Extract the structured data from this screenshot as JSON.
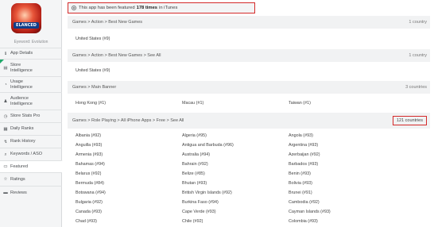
{
  "app": {
    "icon_text": "ELANCED",
    "name": "Eyeword: Evolution"
  },
  "sidebar": {
    "items": [
      {
        "label": "App Details",
        "icon": "info-icon",
        "glyph": "ℹ"
      },
      {
        "label": "Store\nIntelligence",
        "icon": "store-icon",
        "glyph": "▤"
      },
      {
        "label": "Usage\nIntelligence",
        "icon": "usage-icon",
        "glyph": "◔"
      },
      {
        "label": "Audience\nIntelligence",
        "icon": "audience-icon",
        "glyph": "♟"
      },
      {
        "label": "Store Stats Pro",
        "icon": "stats-icon",
        "glyph": "◷"
      },
      {
        "label": "Daily Ranks",
        "icon": "ranks-icon",
        "glyph": "▦"
      },
      {
        "label": "Rank History",
        "icon": "history-icon",
        "glyph": "↯"
      },
      {
        "label": "Keywords / ASO",
        "icon": "keywords-icon",
        "glyph": "⌕"
      },
      {
        "label": "Featured",
        "icon": "featured-icon",
        "glyph": "▭"
      },
      {
        "label": "Ratings",
        "icon": "star-icon",
        "glyph": "☆"
      },
      {
        "label": "Reviews",
        "icon": "reviews-icon",
        "glyph": "▬"
      }
    ],
    "active_index": 8,
    "accent_color": "#1ea868"
  },
  "banner": {
    "prefix": "This app has been featured",
    "count_text": "178 times",
    "suffix": "in iTunes",
    "highlight_color": "#d42a2a"
  },
  "sections": [
    {
      "path": "Games > Action > Best New Games",
      "count": "1 country",
      "rows": [
        [
          "United States (#9)"
        ]
      ]
    },
    {
      "path": "Games > Action > Best New Games > See All",
      "count": "1 country",
      "rows": [
        [
          "United States (#9)"
        ]
      ]
    },
    {
      "path": "Games > Main Banner",
      "count": "3 countries",
      "rows": [
        [
          "Hong Kong (#1)",
          "Macau (#1)",
          "Taiwan (#1)"
        ]
      ]
    },
    {
      "path": "Games > Role Playing > All iPhone Apps > Free > See All",
      "count": "121 countries",
      "rows": [
        [
          "Albania (#92)",
          "Algeria (#95)",
          "Angola (#93)"
        ],
        [
          "Anguilla (#93)",
          "Antigua and Barbuda (#96)",
          "Argentina (#93)"
        ],
        [
          "Armenia (#93)",
          "Australia (#94)",
          "Azerbaijan (#92)"
        ],
        [
          "Bahamas (#94)",
          "Bahrain (#92)",
          "Barbados (#93)"
        ],
        [
          "Belarus (#92)",
          "Belize (#85)",
          "Benin (#93)"
        ],
        [
          "Bermuda (#84)",
          "Bhutan (#93)",
          "Bolivia (#93)"
        ],
        [
          "Botswana (#94)",
          "British Virgin Islands (#92)",
          "Brunei (#91)"
        ],
        [
          "Bulgaria (#92)",
          "Burkina Faso (#94)",
          "Cambodia (#92)"
        ],
        [
          "Canada (#93)",
          "Cape Verde (#93)",
          "Cayman Islands (#93)"
        ],
        [
          "Chad (#93)",
          "Chile (#92)",
          "Colombia (#93)"
        ]
      ]
    }
  ]
}
